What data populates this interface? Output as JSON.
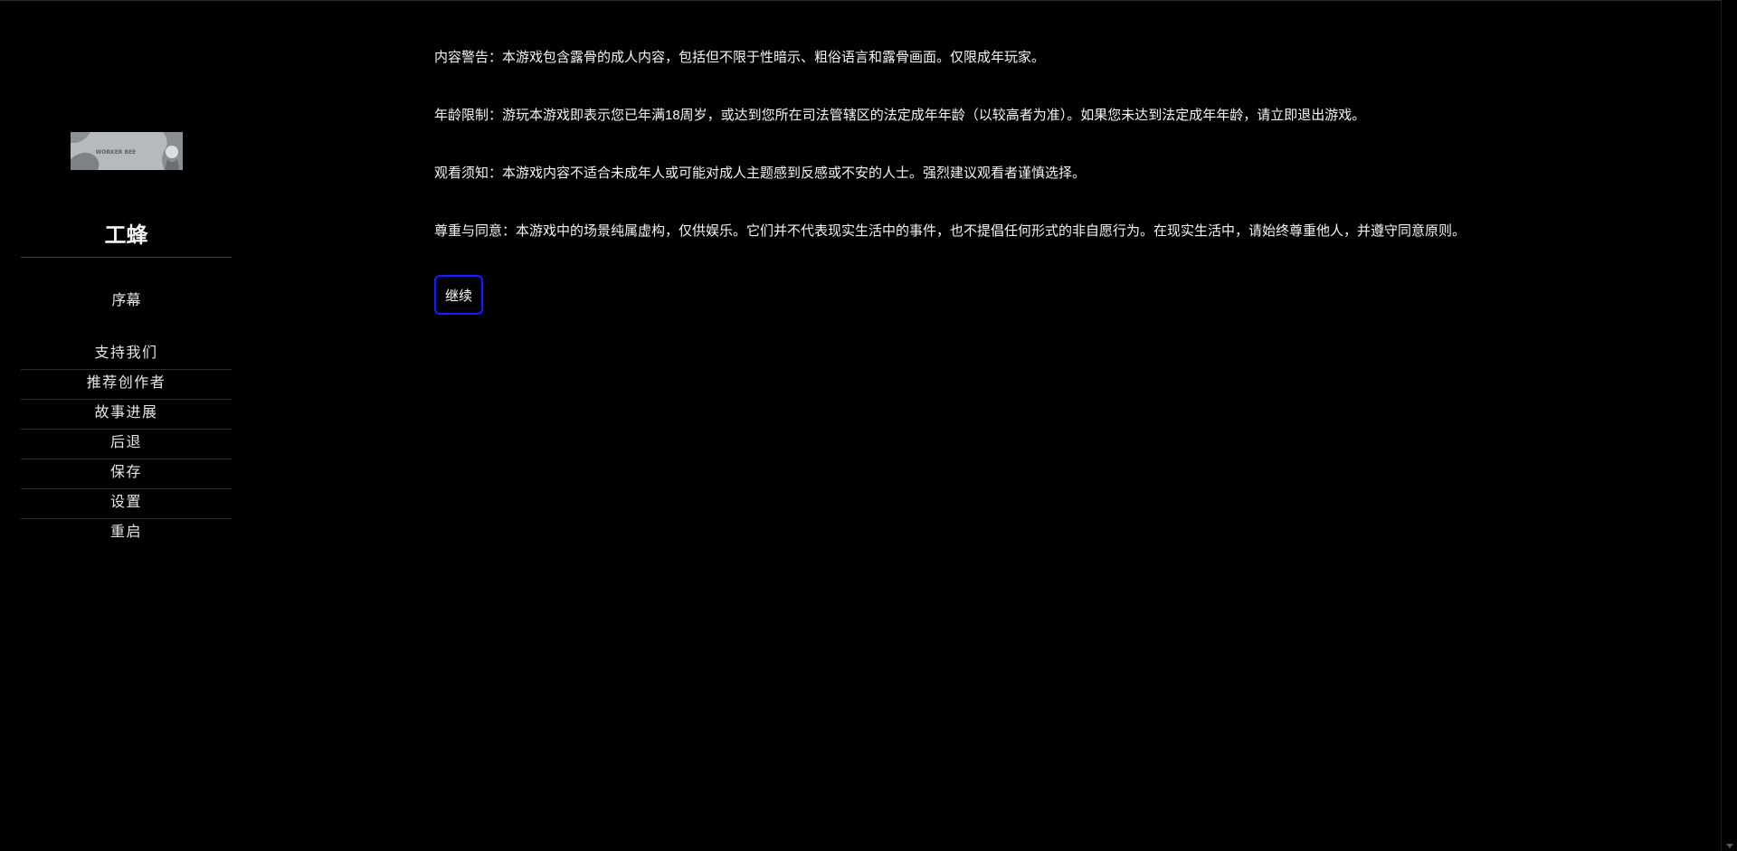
{
  "sidebar": {
    "banner_alt": "WORKER BEE",
    "title": "工蜂",
    "restart_link": "序幕",
    "menu": [
      {
        "label": "支持我们"
      },
      {
        "label": "推荐创作者"
      },
      {
        "label": "故事进展"
      },
      {
        "label": "后退"
      },
      {
        "label": "保存"
      },
      {
        "label": "设置"
      },
      {
        "label": "重启"
      }
    ]
  },
  "passage": {
    "paragraphs": [
      "内容警告：本游戏包含露骨的成人内容，包括但不限于性暗示、粗俗语言和露骨画面。仅限成年玩家。",
      "年龄限制：游玩本游戏即表示您已年满18周岁，或达到您所在司法管辖区的法定成年年龄（以较高者为准）。如果您未达到法定成年年龄，请立即退出游戏。",
      "观看须知：本游戏内容不适合未成年人或可能对成人主题感到反感或不安的人士。强烈建议观看者谨慎选择。",
      "尊重与同意：本游戏中的场景纯属虚构，仅供娱乐。它们并不代表现实生活中的事件，也不提倡任何形式的非自愿行为。在现实生活中，请始终尊重他人，并遵守同意原则。"
    ],
    "continue_label": "继续"
  },
  "colors": {
    "background": "#000000",
    "text": "#f4f4f4",
    "button_border": "#1a1aff"
  }
}
